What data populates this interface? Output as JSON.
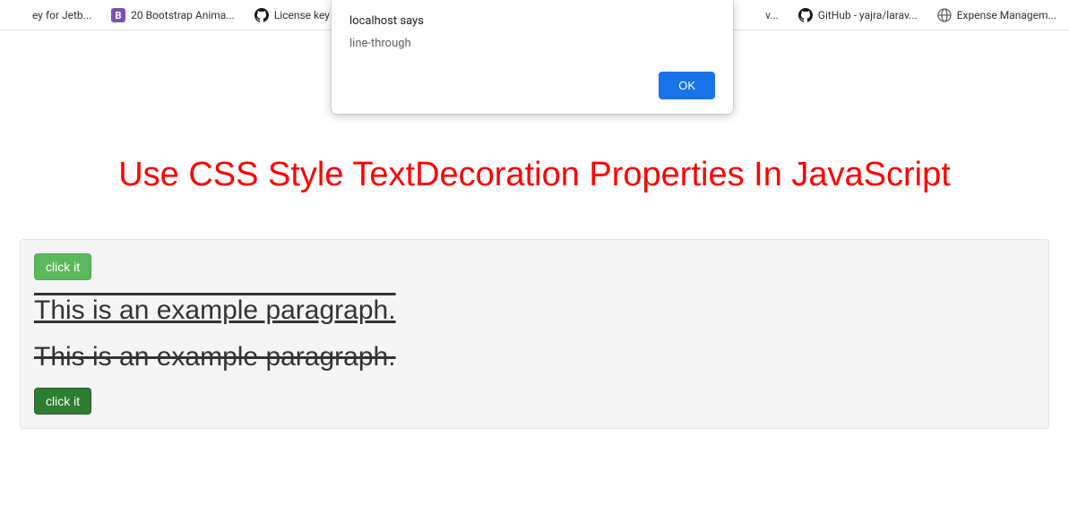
{
  "bookmarks": [
    {
      "label": "ey for Jetb...",
      "icon": "generic"
    },
    {
      "label": "20 Bootstrap Anima...",
      "icon": "boot"
    },
    {
      "label": "License key PhpStor...",
      "icon": "github"
    },
    {
      "label": "v...",
      "icon": "generic"
    },
    {
      "label": "GitHub - yajra/larav...",
      "icon": "github"
    },
    {
      "label": "Expense Managem...",
      "icon": "globe"
    }
  ],
  "alert": {
    "title": "localhost says",
    "message": "line-through",
    "ok": "OK"
  },
  "page": {
    "title": "Use CSS Style TextDecoration Properties In JavaScript",
    "btn1": "click it",
    "para1": "This is an example paragraph.",
    "para2": "This is an example paragraph.",
    "btn2": "click it"
  }
}
